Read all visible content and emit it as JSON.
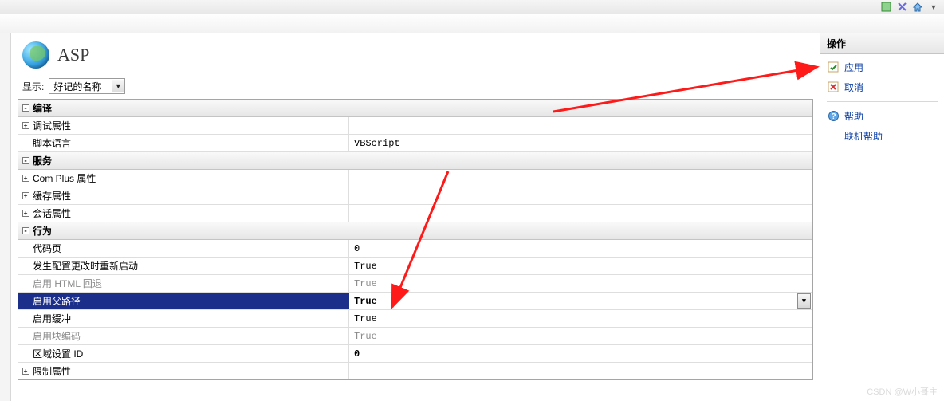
{
  "page": {
    "title": "ASP"
  },
  "display": {
    "label": "显示:",
    "selected": "好记的名称"
  },
  "grid": {
    "sections": {
      "compile": {
        "label": "编译"
      },
      "debug": {
        "label": "调试属性"
      },
      "script": {
        "label": "脚本语言",
        "value": "VBScript"
      },
      "services": {
        "label": "服务"
      },
      "complus": {
        "label": "Com Plus 属性"
      },
      "cache": {
        "label": "缓存属性"
      },
      "session": {
        "label": "会话属性"
      },
      "behavior": {
        "label": "行为"
      },
      "codepage": {
        "label": "代码页",
        "value": "0"
      },
      "restartOnChange": {
        "label": "发生配置更改时重新启动",
        "value": "True"
      },
      "htmlFallback": {
        "label": "启用 HTML 回退",
        "value": "True"
      },
      "parentPaths": {
        "label": "启用父路径",
        "value": "True"
      },
      "buffering": {
        "label": "启用缓冲",
        "value": "True"
      },
      "chunked": {
        "label": "启用块编码",
        "value": "True"
      },
      "localeId": {
        "label": "区域设置 ID",
        "value": "0"
      },
      "limits": {
        "label": "限制属性"
      }
    }
  },
  "actions": {
    "title": "操作",
    "apply": "应用",
    "cancel": "取消",
    "help": "帮助",
    "onlineHelp": "联机帮助"
  }
}
